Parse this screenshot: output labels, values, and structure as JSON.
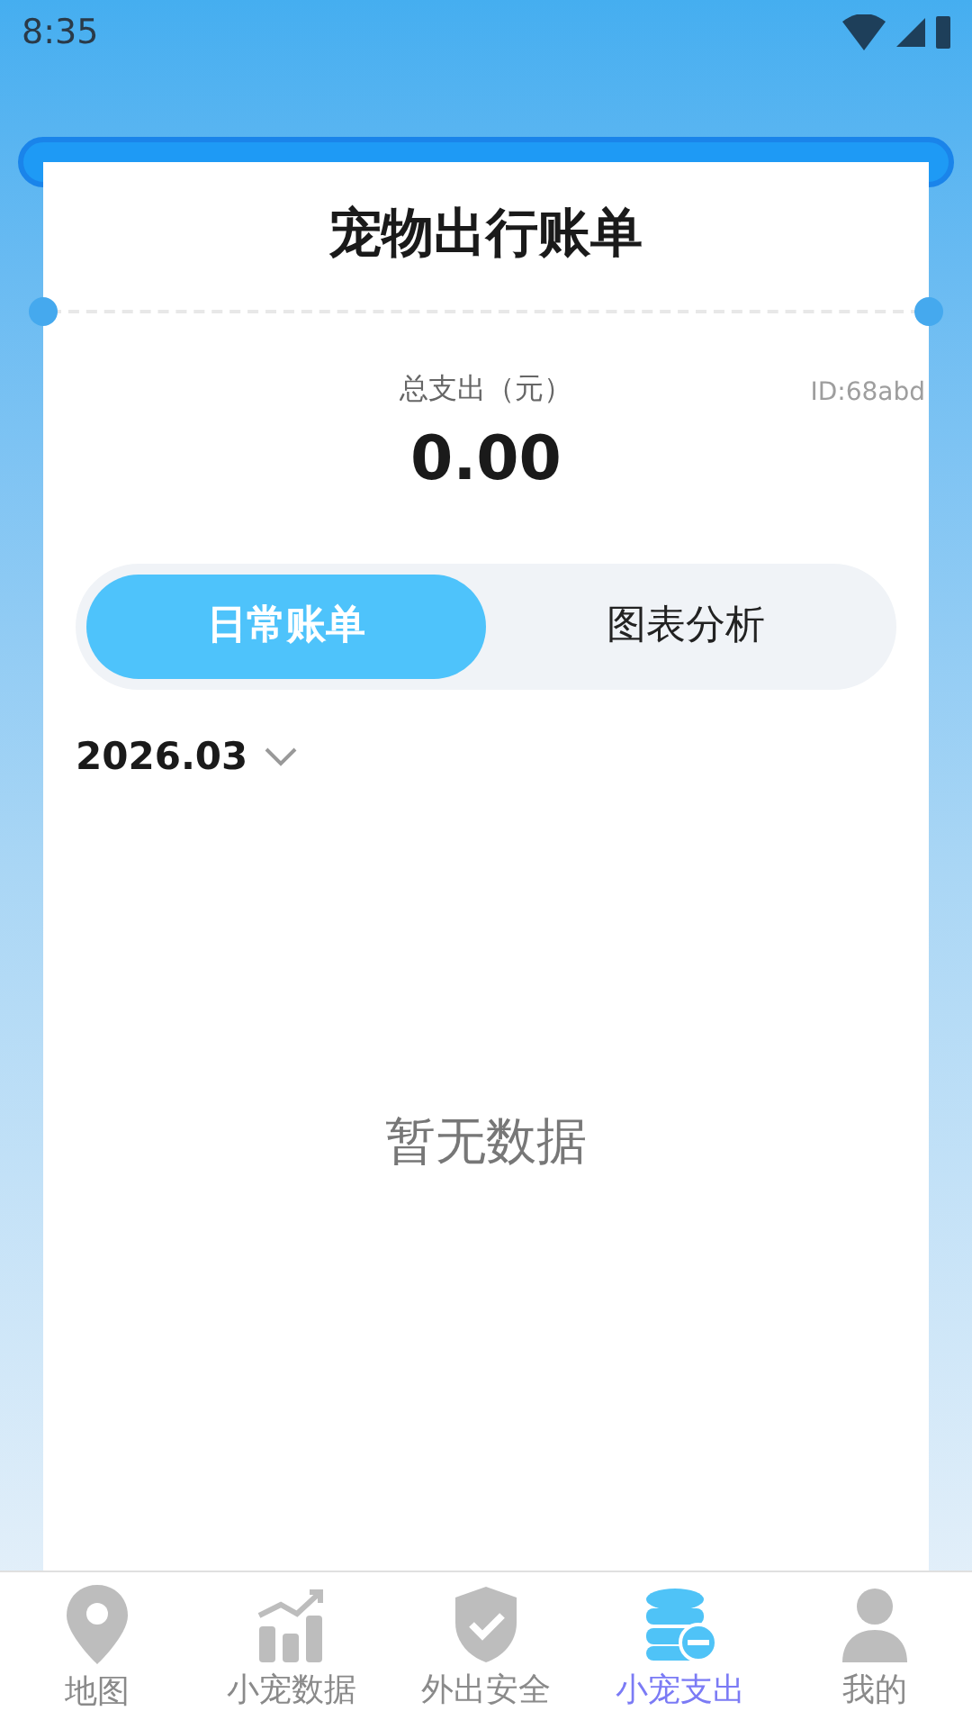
{
  "status_bar": {
    "time": "8:35"
  },
  "title": "宠物出行账单",
  "total": {
    "label": "总支出（元）",
    "amount": "0.00",
    "id": "ID:68abd"
  },
  "segments": [
    {
      "label": "日常账单",
      "selected": true
    },
    {
      "label": "图表分析",
      "selected": false
    }
  ],
  "month": "2026.03",
  "empty_text": "暂无数据",
  "nav": [
    {
      "label": "地图",
      "kind": "pin",
      "selected": false
    },
    {
      "label": "小宠数据",
      "kind": "chart",
      "selected": false
    },
    {
      "label": "外出安全",
      "kind": "shield",
      "selected": false
    },
    {
      "label": "小宠支出",
      "kind": "coins",
      "selected": true
    },
    {
      "label": "我的",
      "kind": "user",
      "selected": false
    }
  ]
}
